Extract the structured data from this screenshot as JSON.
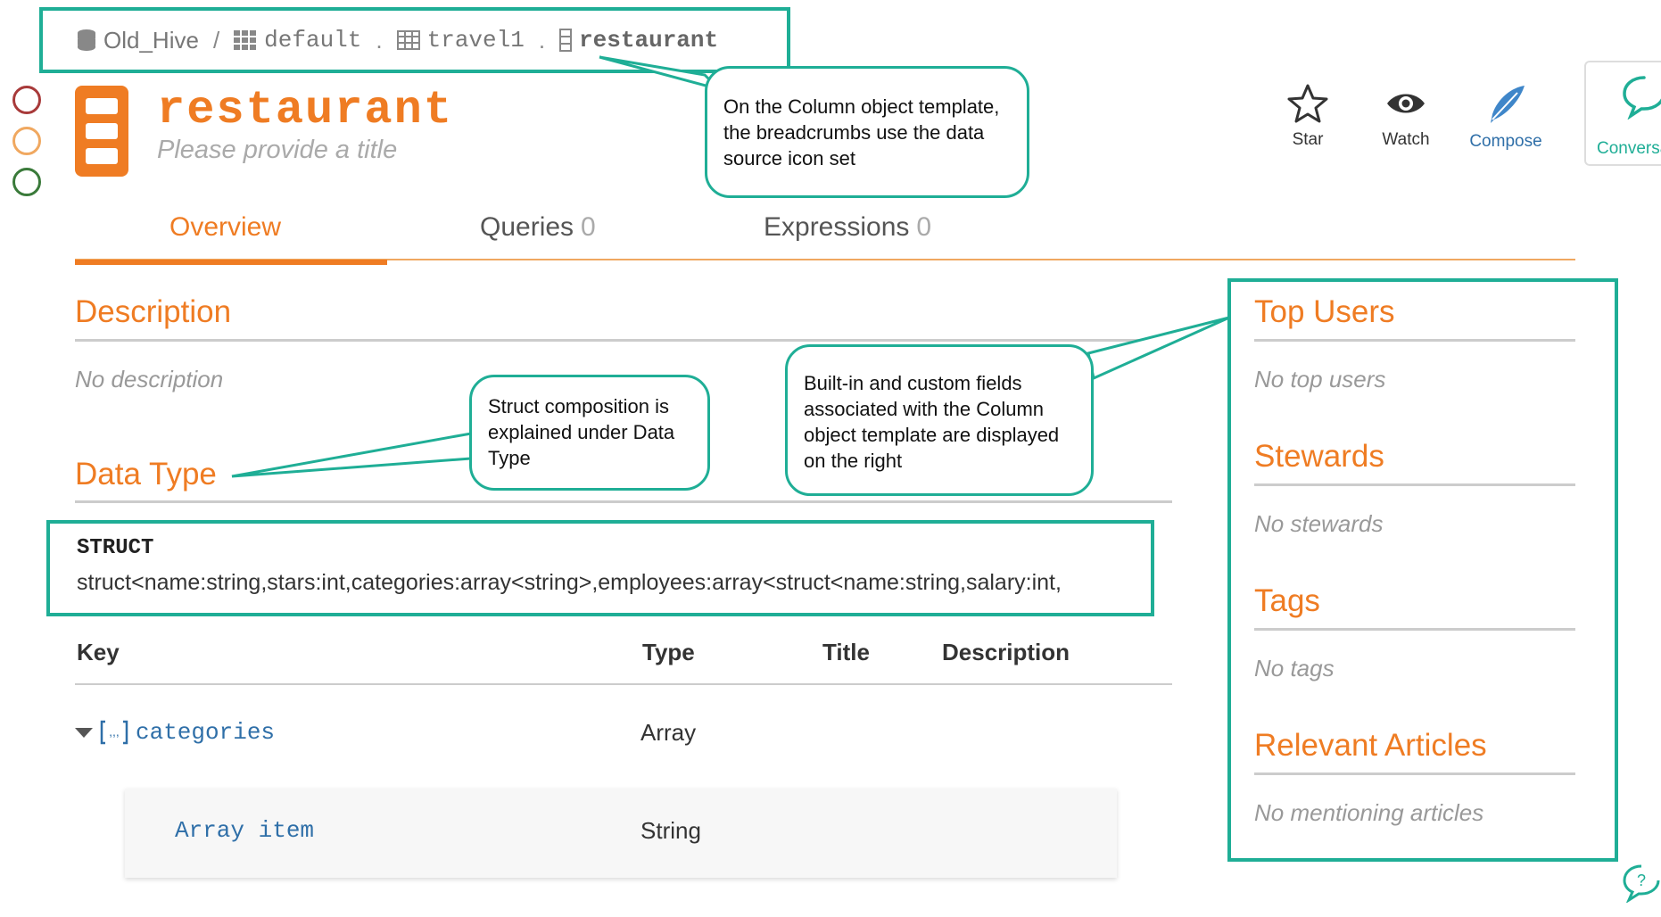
{
  "breadcrumb": {
    "items": [
      {
        "label": "Old_Hive",
        "icon": "database-icon"
      },
      {
        "label": "default",
        "icon": "grid-icon"
      },
      {
        "label": "travel1",
        "icon": "table-icon"
      },
      {
        "label": "restaurant",
        "icon": "column-icon"
      }
    ],
    "separators": [
      "/",
      ".",
      "."
    ]
  },
  "object": {
    "title": "restaurant",
    "subtitle": "Please provide a title"
  },
  "actions": {
    "star": "Star",
    "watch": "Watch",
    "compose": "Compose",
    "conversations": "Conversa"
  },
  "tabs": [
    {
      "label": "Overview",
      "count": ""
    },
    {
      "label": "Queries",
      "count": "0"
    },
    {
      "label": "Expressions",
      "count": "0"
    }
  ],
  "description": {
    "heading": "Description",
    "empty": "No description"
  },
  "data_type": {
    "heading": "Data Type",
    "kind": "STRUCT",
    "definition": "struct<name:string,stars:int,categories:array<string>,employees:array<struct<name:string,salary:int,"
  },
  "fields_table": {
    "headers": {
      "key": "Key",
      "type": "Type",
      "title": "Title",
      "description": "Description"
    },
    "rows": [
      {
        "key": "categories",
        "type": "Array",
        "icon": "array-icon"
      },
      {
        "key": "Array item",
        "type": "String"
      }
    ]
  },
  "sidebar": {
    "top_users": {
      "heading": "Top Users",
      "empty": "No top users"
    },
    "stewards": {
      "heading": "Stewards",
      "empty": "No stewards"
    },
    "tags": {
      "heading": "Tags",
      "empty": "No tags"
    },
    "articles": {
      "heading": "Relevant Articles",
      "empty": "No mentioning articles"
    }
  },
  "callouts": {
    "breadcrumbs": "On the Column object template, the breadcrumbs use the data source icon set",
    "struct": "Struct composition is explained under Data Type",
    "fields": "Built-in and custom fields associated with the Column object template are displayed on the right"
  },
  "colors": {
    "accent": "#ef7c23",
    "highlight": "#1fae96",
    "link": "#2f6fa8",
    "trust_red": "#a83a3a",
    "trust_orange": "#f0a860",
    "trust_green": "#3a7a3a"
  }
}
